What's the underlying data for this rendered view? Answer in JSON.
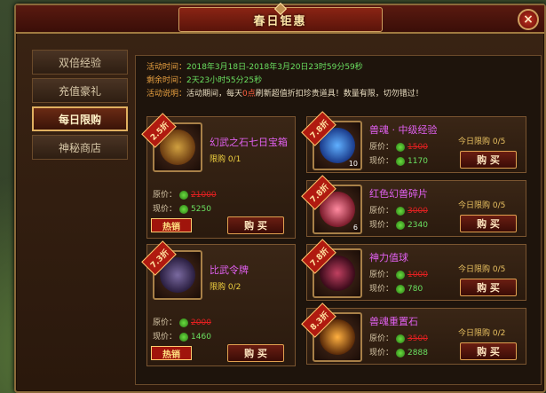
{
  "window": {
    "title": "春日钜惠",
    "close_glyph": "×"
  },
  "sidebar": {
    "items": [
      {
        "label": "双倍经验"
      },
      {
        "label": "充值豪礼"
      },
      {
        "label": "每日限购"
      },
      {
        "label": "神秘商店"
      }
    ]
  },
  "info": {
    "time_label": "活动时间：",
    "time_value": "2018年3月18日-2018年3月20日23时59分59秒",
    "remain_label": "剩余时间：",
    "remain_value": "2天23小时55分25秒",
    "desc_label": "活动说明：",
    "desc_pre": "活动期间，每天",
    "desc_hl": "0点",
    "desc_post": "刷新超值折扣珍贵道具！数量有限，切勿错过！"
  },
  "labels": {
    "orig": "原价：",
    "cur": "现价：",
    "limit_prefix": "限购",
    "today_prefix": "今日限购",
    "buy": "购 买",
    "hot": "热销"
  },
  "left_items": [
    {
      "name": "幻武之石七日宝箱",
      "discount": "2.5折",
      "limit": "0/1",
      "orig": "21000",
      "cur": "5250"
    },
    {
      "name": "比武令牌",
      "discount": "7.3折",
      "limit": "0/2",
      "orig": "2000",
      "cur": "1460"
    }
  ],
  "right_items": [
    {
      "name": "兽魂 · 中级经验",
      "discount": "7.8折",
      "qty": "10",
      "limit": "0/5",
      "orig": "1500",
      "cur": "1170"
    },
    {
      "name": "红色幻兽碎片",
      "discount": "7.8折",
      "qty": "6",
      "limit": "0/5",
      "orig": "3000",
      "cur": "2340"
    },
    {
      "name": "神力值球",
      "discount": "7.8折",
      "qty": "",
      "limit": "0/5",
      "orig": "1000",
      "cur": "780"
    },
    {
      "name": "兽魂重置石",
      "discount": "8.3折",
      "qty": "",
      "limit": "0/2",
      "orig": "3500",
      "cur": "2888"
    }
  ],
  "colors": {
    "accent": "#e0b060",
    "name": "#e060f0",
    "price_now": "#6ae060",
    "price_old": "#e02020"
  }
}
